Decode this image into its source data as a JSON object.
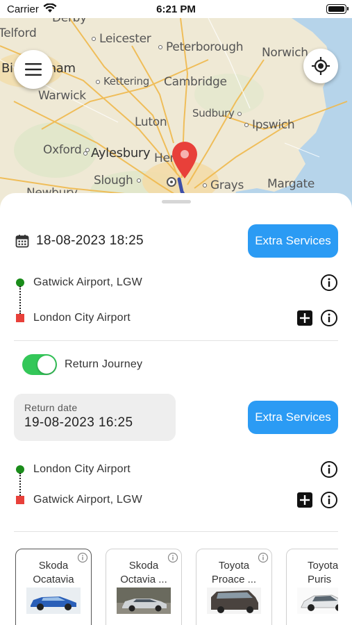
{
  "status_bar": {
    "carrier": "Carrier",
    "time": "6:21 PM"
  },
  "map": {
    "cities": [
      "Derby",
      "Telford",
      "Leicester",
      "Peterborough",
      "Norwich",
      "Birmingham",
      "Kettering",
      "Cambridge",
      "Warwick",
      "Sudbury",
      "Ipswich",
      "Luton",
      "Oxford",
      "Aylesbury",
      "Hertford",
      "Slough",
      "Grays",
      "Margate",
      "Newbury"
    ]
  },
  "booking": {
    "date": "18-08-2023 18:25",
    "extra_services_label": "Extra Services",
    "pickup": "Gatwick Airport, LGW",
    "dropoff": "London City Airport"
  },
  "return": {
    "toggle_label": "Return Journey",
    "toggle_on": true,
    "date_caption": "Return date",
    "date_value": "19-08-2023 16:25",
    "extra_services_label": "Extra Services",
    "pickup": "London City Airport",
    "dropoff": "Gatwick Airport, LGW"
  },
  "cars": [
    {
      "line1": "Skoda",
      "line2": "Ocatavia",
      "selected": true
    },
    {
      "line1": "Skoda",
      "line2": "Octavia ...",
      "selected": false
    },
    {
      "line1": "Toyota",
      "line2": "Proace ...",
      "selected": false
    },
    {
      "line1": "Toyota",
      "line2": "Puris",
      "selected": false
    }
  ],
  "colors": {
    "accent": "#2b9bf4",
    "toggle": "#34c759",
    "pickup": "#1a8c1a",
    "dropoff": "#e8403a",
    "pin": "#e8403a"
  }
}
